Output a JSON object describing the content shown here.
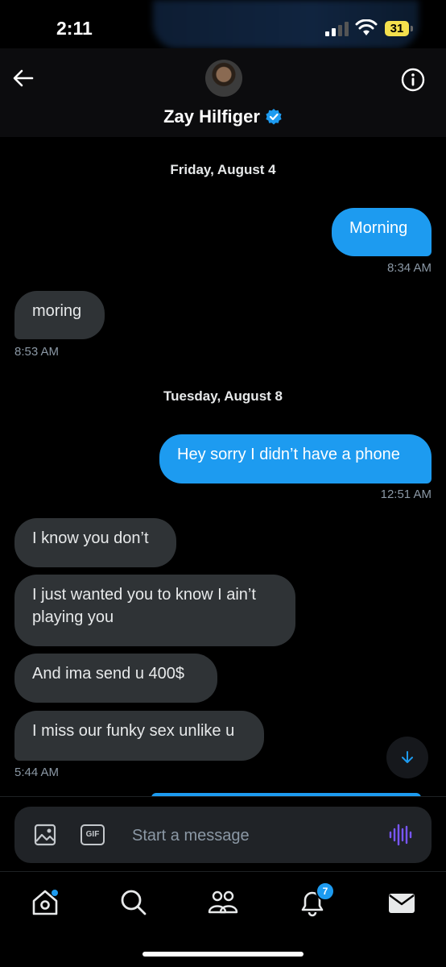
{
  "status_bar": {
    "time": "2:11",
    "battery": "31"
  },
  "header": {
    "contact_name": "Zay Hilfiger",
    "verified": true,
    "back_icon": "arrow-left-icon",
    "info_icon": "info-icon"
  },
  "conversation": {
    "dates": [
      "Friday, August 4",
      "Tuesday, August 8"
    ],
    "messages": [
      {
        "side": "sent",
        "text": "Morning",
        "time": "8:34 AM"
      },
      {
        "side": "received",
        "text": "moring",
        "time": "8:53 AM"
      },
      {
        "side": "sent",
        "text": "Hey sorry I didn’t have a phone",
        "time": "12:51 AM"
      },
      {
        "side": "received",
        "text": "I know you don’t"
      },
      {
        "side": "received",
        "text": "I just wanted you to know I ain’t playing you"
      },
      {
        "side": "received",
        "text": "And ima send u 400$"
      },
      {
        "side": "received",
        "text": "I miss our funky sex unlike u",
        "time": "5:44 AM"
      }
    ]
  },
  "composer": {
    "placeholder": "Start a message",
    "gif_label": "GIF"
  },
  "nav": {
    "notifications_badge": "7"
  },
  "colors": {
    "accent": "#1d9bf0",
    "received_bubble": "#2f3336",
    "background": "#000000"
  }
}
